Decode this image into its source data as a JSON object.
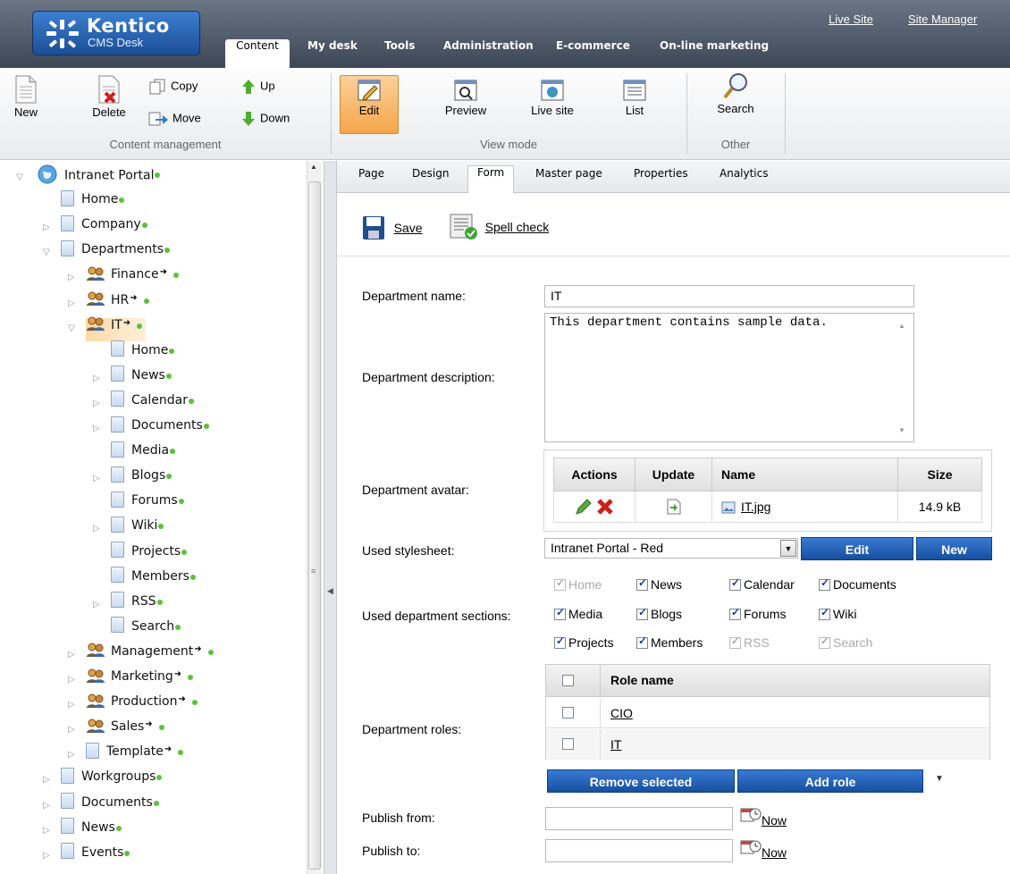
{
  "app": {
    "brand": "Kentico",
    "subtitle": "CMS Desk"
  },
  "top_links": {
    "live_site": "Live Site",
    "site_manager": "Site Manager"
  },
  "main_tabs": [
    "Content",
    "My desk",
    "Tools",
    "Administration",
    "E-commerce",
    "On-line marketing"
  ],
  "ribbon": {
    "new": "New",
    "delete": "Delete",
    "copy": "Copy",
    "move": "Move",
    "up": "Up",
    "down": "Down",
    "edit": "Edit",
    "preview": "Preview",
    "live_site": "Live site",
    "list": "List",
    "search": "Search",
    "group_content": "Content management",
    "group_view": "View mode",
    "group_other": "Other"
  },
  "tree": [
    {
      "label": "Intranet Portal",
      "level": 0
    },
    {
      "label": "Home",
      "level": 1
    },
    {
      "label": "Company",
      "level": 1
    },
    {
      "label": "Departments",
      "level": 1
    },
    {
      "label": "Finance",
      "level": 2
    },
    {
      "label": "HR",
      "level": 2
    },
    {
      "label": "IT",
      "level": 2,
      "selected": true
    },
    {
      "label": "Home",
      "level": 3
    },
    {
      "label": "News",
      "level": 3
    },
    {
      "label": "Calendar",
      "level": 3
    },
    {
      "label": "Documents",
      "level": 3
    },
    {
      "label": "Media",
      "level": 3
    },
    {
      "label": "Blogs",
      "level": 3
    },
    {
      "label": "Forums",
      "level": 3
    },
    {
      "label": "Wiki",
      "level": 3
    },
    {
      "label": "Projects",
      "level": 3
    },
    {
      "label": "Members",
      "level": 3
    },
    {
      "label": "RSS",
      "level": 3
    },
    {
      "label": "Search",
      "level": 3
    },
    {
      "label": "Management",
      "level": 2
    },
    {
      "label": "Marketing",
      "level": 2
    },
    {
      "label": "Production",
      "level": 2
    },
    {
      "label": "Sales",
      "level": 2
    },
    {
      "label": "Template",
      "level": 2
    },
    {
      "label": "Workgroups",
      "level": 1
    },
    {
      "label": "Documents",
      "level": 1
    },
    {
      "label": "News",
      "level": 1
    },
    {
      "label": "Events",
      "level": 1
    }
  ],
  "page_tabs": [
    "Page",
    "Design",
    "Form",
    "Master page",
    "Properties",
    "Analytics"
  ],
  "actions": {
    "save": "Save",
    "spell_check": "Spell check"
  },
  "form": {
    "dept_name_label": "Department name:",
    "dept_name_value": "IT",
    "dept_desc_label": "Department description:",
    "dept_desc_value": "This department contains sample data.",
    "avatar_label": "Department avatar:",
    "avatar_table": {
      "headers": [
        "Actions",
        "Update",
        "Name",
        "Size"
      ],
      "file_name": "IT.jpg",
      "file_size": "14.9 kB"
    },
    "stylesheet_label": "Used stylesheet:",
    "stylesheet_value": "Intranet Portal - Red",
    "stylesheet_edit": "Edit",
    "stylesheet_new": "New",
    "sections_label": "Used department sections:",
    "sections": [
      {
        "label": "Home",
        "checked": true,
        "disabled": true
      },
      {
        "label": "News",
        "checked": true,
        "disabled": false
      },
      {
        "label": "Calendar",
        "checked": true,
        "disabled": false
      },
      {
        "label": "Documents",
        "checked": true,
        "disabled": false
      },
      {
        "label": "Media",
        "checked": true,
        "disabled": false
      },
      {
        "label": "Blogs",
        "checked": true,
        "disabled": false
      },
      {
        "label": "Forums",
        "checked": true,
        "disabled": false
      },
      {
        "label": "Wiki",
        "checked": true,
        "disabled": false
      },
      {
        "label": "Projects",
        "checked": true,
        "disabled": false
      },
      {
        "label": "Members",
        "checked": true,
        "disabled": false
      },
      {
        "label": "RSS",
        "checked": true,
        "disabled": true
      },
      {
        "label": "Search",
        "checked": true,
        "disabled": true
      }
    ],
    "roles_label": "Department roles:",
    "roles_header": "Role name",
    "roles": [
      "CIO",
      "IT"
    ],
    "remove_selected": "Remove selected",
    "add_role": "Add role",
    "publish_from_label": "Publish from:",
    "publish_to_label": "Publish to:",
    "now": "Now"
  },
  "colors": {
    "accent_orange": "#f4a649",
    "button_blue": "#1b5bb0",
    "status_green": "#5cc13b"
  }
}
